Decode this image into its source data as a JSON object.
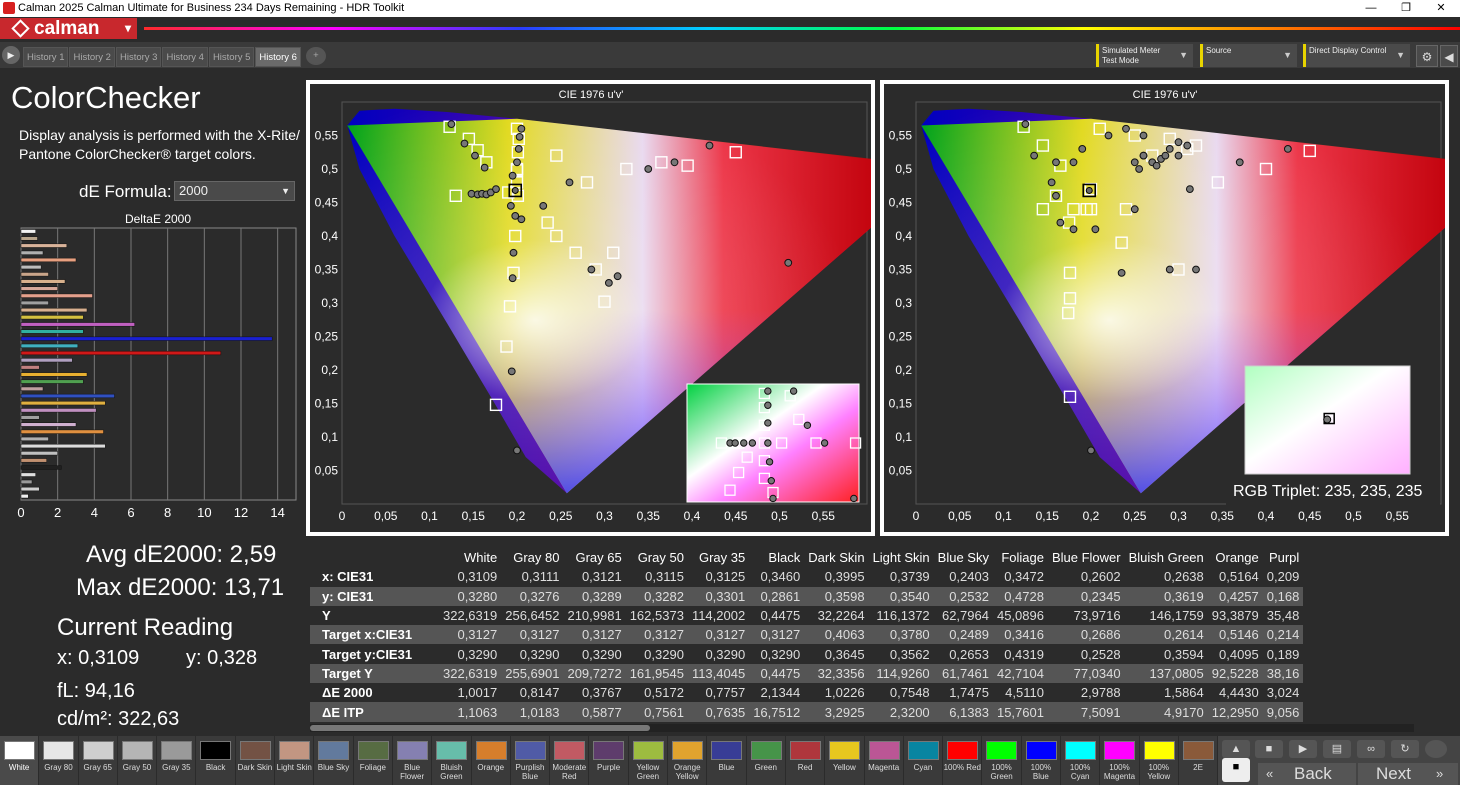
{
  "window": {
    "title": "Calman 2025 Calman Ultimate for Business 234 Days Remaining  - HDR Toolkit"
  },
  "brand": "calman",
  "tabs": [
    "History 1",
    "History 2",
    "History 3",
    "History 4",
    "History 5",
    "History 6"
  ],
  "tab_add": "+",
  "toolbar": {
    "meter": [
      "Simulated Meter",
      "Test Mode"
    ],
    "source": "Source",
    "ddc": "Direct Display Control"
  },
  "page": {
    "title": "ColorChecker",
    "description": "Display analysis is performed with the X-Rite/ Pantone ColorChecker® target colors.",
    "formula_label": "dE Formula:",
    "formula_value": "2000"
  },
  "delta_chart": {
    "title": "DeltaE 2000",
    "ticks": [
      "0",
      "2",
      "4",
      "6",
      "8",
      "10",
      "12",
      "14"
    ],
    "xmax": 15,
    "bars": [
      {
        "v": 0.8,
        "c": "#f2f2f2"
      },
      {
        "v": 0.9,
        "c": "#b8a58c"
      },
      {
        "v": 2.5,
        "c": "#d9b39a"
      },
      {
        "v": 1.2,
        "c": "#b0b0b0"
      },
      {
        "v": 3.0,
        "c": "#e8a080"
      },
      {
        "v": 1.1,
        "c": "#bdbdbd"
      },
      {
        "v": 1.5,
        "c": "#c9a58a"
      },
      {
        "v": 2.4,
        "c": "#d7b08c"
      },
      {
        "v": 2.0,
        "c": "#d7a89a"
      },
      {
        "v": 3.9,
        "c": "#e4a08c"
      },
      {
        "v": 1.5,
        "c": "#a0a0a0"
      },
      {
        "v": 3.6,
        "c": "#d8b090"
      },
      {
        "v": 3.4,
        "c": "#d4c040"
      },
      {
        "v": 6.2,
        "c": "#c060c0"
      },
      {
        "v": 3.4,
        "c": "#30b0a0"
      },
      {
        "v": 13.7,
        "c": "#1a20d0"
      },
      {
        "v": 3.1,
        "c": "#40b0c0"
      },
      {
        "v": 10.9,
        "c": "#d01818"
      },
      {
        "v": 2.8,
        "c": "#b0a0c0"
      },
      {
        "v": 1.0,
        "c": "#c08080"
      },
      {
        "v": 3.6,
        "c": "#e8b030"
      },
      {
        "v": 3.4,
        "c": "#50a050"
      },
      {
        "v": 1.2,
        "c": "#c0a0a0"
      },
      {
        "v": 5.1,
        "c": "#3050c0"
      },
      {
        "v": 4.6,
        "c": "#e0b040"
      },
      {
        "v": 4.1,
        "c": "#c090c0"
      },
      {
        "v": 1.0,
        "c": "#a0a0a0"
      },
      {
        "v": 3.0,
        "c": "#d0b0d0"
      },
      {
        "v": 4.5,
        "c": "#e09040"
      },
      {
        "v": 1.5,
        "c": "#b0b0b0"
      },
      {
        "v": 4.6,
        "c": "#dcdcdc"
      },
      {
        "v": 2.0,
        "c": "#c0c0c0"
      },
      {
        "v": 1.4,
        "c": "#c09070"
      },
      {
        "v": 2.2,
        "c": "#202020"
      },
      {
        "v": 0.8,
        "c": "#e0e0e0"
      },
      {
        "v": 0.6,
        "c": "#9a9a9a"
      },
      {
        "v": 1.0,
        "c": "#cfcfcf"
      },
      {
        "v": 0.4,
        "c": "#f0f0f0"
      }
    ]
  },
  "stats": {
    "avg": "Avg dE2000: 2,59",
    "max": "Max dE2000: 13,71"
  },
  "current": {
    "heading": "Current Reading",
    "x": "x: 0,3109",
    "y": "y: 0,328",
    "fl": "fL: 94,16",
    "cdm2": "cd/m²: 322,63"
  },
  "cie_plots": {
    "title": "CIE 1976 u'v'",
    "xticks": [
      "0",
      "0,05",
      "0,1",
      "0,15",
      "0,2",
      "0,25",
      "0,3",
      "0,35",
      "0,4",
      "0,45",
      "0,5",
      "0,55"
    ],
    "yticks": [
      "0,05",
      "0,1",
      "0,15",
      "0,2",
      "0,25",
      "0,3",
      "0,35",
      "0,4",
      "0,45",
      "0,5",
      "0,55"
    ]
  },
  "rgb_triplet": "RGB Triplet: 235, 235, 235",
  "table": {
    "columns": [
      "White",
      "Gray 80",
      "Gray 65",
      "Gray 50",
      "Gray 35",
      "Black",
      "Dark Skin",
      "Light Skin",
      "Blue Sky",
      "Foliage",
      "Blue Flower",
      "Bluish Green",
      "Orange",
      "Purpl"
    ],
    "rows": [
      {
        "label": "x: CIE31",
        "cells": [
          "0,3109",
          "0,3111",
          "0,3121",
          "0,3115",
          "0,3125",
          "0,3460",
          "0,3995",
          "0,3739",
          "0,2403",
          "0,3472",
          "0,2602",
          "0,2638",
          "0,5164",
          "0,209"
        ]
      },
      {
        "label": "y: CIE31",
        "cells": [
          "0,3280",
          "0,3276",
          "0,3289",
          "0,3282",
          "0,3301",
          "0,2861",
          "0,3598",
          "0,3540",
          "0,2532",
          "0,4728",
          "0,2345",
          "0,3619",
          "0,4257",
          "0,168"
        ]
      },
      {
        "label": "Y",
        "cells": [
          "322,6319",
          "256,6452",
          "210,9981",
          "162,5373",
          "114,2002",
          "0,4475",
          "32,2264",
          "116,1372",
          "62,7964",
          "45,0896",
          "73,9716",
          "146,1759",
          "93,3879",
          "35,48"
        ]
      },
      {
        "label": "Target x:CIE31",
        "cells": [
          "0,3127",
          "0,3127",
          "0,3127",
          "0,3127",
          "0,3127",
          "0,3127",
          "0,4063",
          "0,3780",
          "0,2489",
          "0,3416",
          "0,2686",
          "0,2614",
          "0,5146",
          "0,214"
        ]
      },
      {
        "label": "Target y:CIE31",
        "cells": [
          "0,3290",
          "0,3290",
          "0,3290",
          "0,3290",
          "0,3290",
          "0,3290",
          "0,3645",
          "0,3562",
          "0,2653",
          "0,4319",
          "0,2528",
          "0,3594",
          "0,4095",
          "0,189"
        ]
      },
      {
        "label": "Target Y",
        "cells": [
          "322,6319",
          "255,6901",
          "209,7272",
          "161,9545",
          "113,4045",
          "0,4475",
          "32,3356",
          "114,9260",
          "61,7461",
          "42,7104",
          "77,0340",
          "137,0805",
          "92,5228",
          "38,16"
        ]
      },
      {
        "label": "ΔE 2000",
        "cells": [
          "1,0017",
          "0,8147",
          "0,3767",
          "0,5172",
          "0,7757",
          "2,1344",
          "1,0226",
          "0,7548",
          "1,7475",
          "4,5110",
          "2,9788",
          "1,5864",
          "4,4430",
          "3,024"
        ]
      },
      {
        "label": "ΔE ITP",
        "cells": [
          "1,1063",
          "1,0183",
          "0,5877",
          "0,7561",
          "0,7635",
          "16,7512",
          "3,2925",
          "2,3200",
          "6,1383",
          "15,7601",
          "7,5091",
          "4,9170",
          "12,2950",
          "9,056"
        ]
      }
    ]
  },
  "swatches": [
    {
      "label": "White",
      "color": "#ffffff"
    },
    {
      "label": "Gray 80",
      "color": "#e6e6e6"
    },
    {
      "label": "Gray 65",
      "color": "#cfcfcf"
    },
    {
      "label": "Gray 50",
      "color": "#b5b5b5"
    },
    {
      "label": "Gray 35",
      "color": "#9a9a9a"
    },
    {
      "label": "Black",
      "color": "#000000"
    },
    {
      "label": "Dark Skin",
      "color": "#735244"
    },
    {
      "label": "Light Skin",
      "color": "#c29682"
    },
    {
      "label": "Blue Sky",
      "color": "#627a9d"
    },
    {
      "label": "Foliage",
      "color": "#576c43"
    },
    {
      "label": "Blue Flower",
      "color": "#8580b1"
    },
    {
      "label": "Bluish Green",
      "color": "#67bdaa"
    },
    {
      "label": "Orange",
      "color": "#d67e2c"
    },
    {
      "label": "Purplish Blue",
      "color": "#505ba6"
    },
    {
      "label": "Moderate Red",
      "color": "#c15a63"
    },
    {
      "label": "Purple",
      "color": "#5e3c6c"
    },
    {
      "label": "Yellow Green",
      "color": "#9dbc40"
    },
    {
      "label": "Orange Yellow",
      "color": "#e0a32e"
    },
    {
      "label": "Blue",
      "color": "#383d96"
    },
    {
      "label": "Green",
      "color": "#469449"
    },
    {
      "label": "Red",
      "color": "#af363c"
    },
    {
      "label": "Yellow",
      "color": "#e7c71f"
    },
    {
      "label": "Magenta",
      "color": "#bb5695"
    },
    {
      "label": "Cyan",
      "color": "#0885a1"
    },
    {
      "label": "100% Red",
      "color": "#ff0000"
    },
    {
      "label": "100% Green",
      "color": "#00ff00"
    },
    {
      "label": "100% Blue",
      "color": "#0000ff"
    },
    {
      "label": "100% Cyan",
      "color": "#00ffff"
    },
    {
      "label": "100% Magenta",
      "color": "#ff00ff"
    },
    {
      "label": "100% Yellow",
      "color": "#ffff00"
    },
    {
      "label": "2E",
      "color": "#8a5a3a"
    }
  ],
  "nav": {
    "back": "Back",
    "next": "Next"
  }
}
